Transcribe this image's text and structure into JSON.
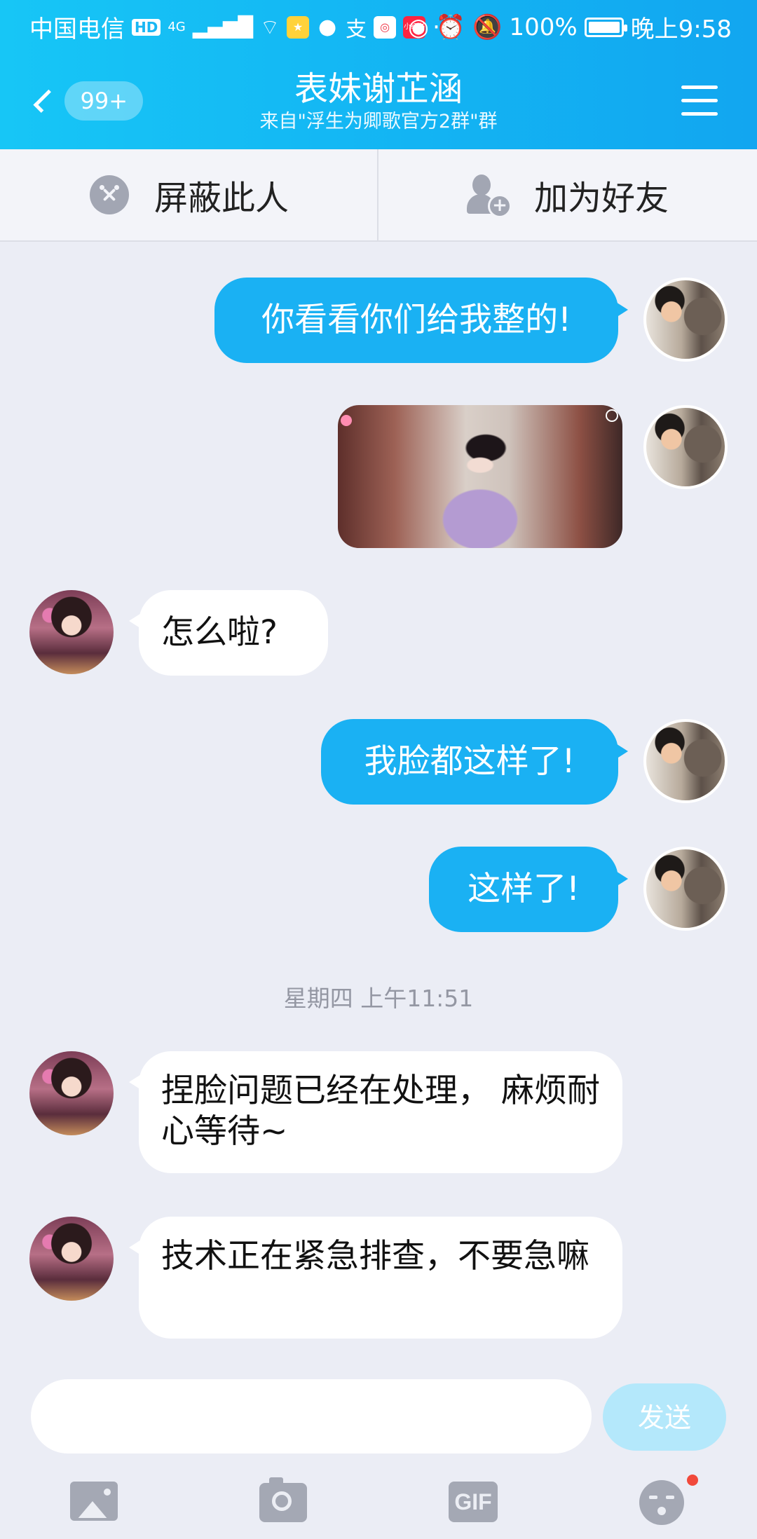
{
  "status_bar": {
    "carrier": "中国电信",
    "hd": "HD",
    "network": "4G",
    "small_app_label": "小红书",
    "more": "···",
    "battery": "100%",
    "time": "晚上9:58"
  },
  "header": {
    "back_badge": "99+",
    "title": "表妹谢芷涵",
    "subtitle": "来自\"浮生为卿歌官方2群\"群"
  },
  "actions": {
    "block_label": "屏蔽此人",
    "add_friend_label": "加为好友"
  },
  "messages": [
    {
      "from": "me",
      "type": "text",
      "text": "你看看你们给我整的!"
    },
    {
      "from": "me",
      "type": "image"
    },
    {
      "from": "them",
      "type": "text",
      "text": "怎么啦?"
    },
    {
      "from": "me",
      "type": "text",
      "text": "我脸都这样了!"
    },
    {
      "from": "me",
      "type": "text",
      "text": "这样了!"
    },
    {
      "type": "timestamp",
      "text": "星期四 上午11:51"
    },
    {
      "from": "them",
      "type": "text",
      "text": "捏脸问题已经在处理， 麻烦耐心等待~"
    },
    {
      "from": "them",
      "type": "text",
      "text": "技术正在紧急排查，不要急嘛"
    }
  ],
  "input": {
    "value": "",
    "placeholder": "",
    "send_label": "发送"
  },
  "toolbar": {
    "gif_label": "GIF"
  },
  "colors": {
    "header_gradient": [
      "#17c6f6",
      "#12a6f0"
    ],
    "outgoing_bubble": "#1ab1f3",
    "incoming_bubble": "#ffffff",
    "background": "#ebedf5",
    "send_button_disabled": "#b4e8fb",
    "notification_dot": "#f1493b"
  }
}
